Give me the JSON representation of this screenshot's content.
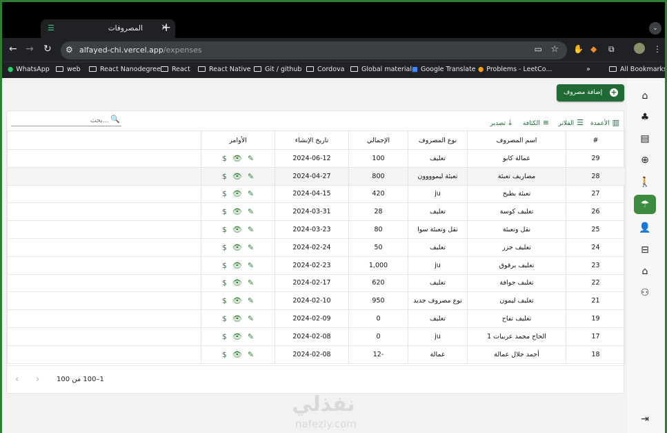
{
  "browser": {
    "tab_title": "المصروفات",
    "tab_close": "✕",
    "new_tab": "+",
    "url_host": "alfayed-chi.vercel.app",
    "url_path": "/expenses",
    "all_bookmarks": "All Bookmarks",
    "bookmarks": [
      "WhatsApp",
      "web",
      "React Nanodegree",
      "React",
      "React Native",
      "Git / github",
      "Cordova",
      "Global material",
      "Google Translate",
      "Problems - LeetCo..."
    ]
  },
  "header": {
    "add_button": "إضافة مصروف"
  },
  "toolbar": {
    "columns": "الأعمدة",
    "filters": "الفلاتر",
    "density": "الكثافة",
    "export": "تصدير",
    "search_placeholder": "بحث..."
  },
  "table": {
    "columns": [
      "#",
      "اسم المصروف",
      "نوع المصروف",
      "الإجمالي",
      "تاريخ الإنشاء",
      "الأوامر"
    ],
    "rows": [
      {
        "id": "29",
        "name": "عمالة كابو",
        "type": "تغليف",
        "total": "100",
        "date": "2024-06-12"
      },
      {
        "id": "28",
        "name": "مصاريف تعبئة",
        "type": "تعبئة ليموووون",
        "total": "800",
        "date": "2024-04-27"
      },
      {
        "id": "27",
        "name": "تعبئة بطيخ",
        "type": "ju",
        "total": "420",
        "date": "2024-04-15"
      },
      {
        "id": "26",
        "name": "تغليف كوسة",
        "type": "تغليف",
        "total": "28",
        "date": "2024-03-31"
      },
      {
        "id": "25",
        "name": "نقل وتعبئة",
        "type": "نقل وتعبئة سوا",
        "total": "80",
        "date": "2024-03-23"
      },
      {
        "id": "24",
        "name": "تغليف جزر",
        "type": "تغليف",
        "total": "50",
        "date": "2024-02-24"
      },
      {
        "id": "23",
        "name": "تغليف برقوق",
        "type": "ju",
        "total": "1,000",
        "date": "2024-02-23"
      },
      {
        "id": "22",
        "name": "تغليف جوافة",
        "type": "تغليف",
        "total": "620",
        "date": "2024-02-17"
      },
      {
        "id": "21",
        "name": "تغليف ليمون",
        "type": "نوع مصروف جديد",
        "total": "950",
        "date": "2024-02-10"
      },
      {
        "id": "19",
        "name": "تغليف تفاح",
        "type": "تغليف",
        "total": "0",
        "date": "2024-02-09"
      },
      {
        "id": "17",
        "name": "الحاج محمد عربيات 1",
        "type": "ju",
        "total": "0",
        "date": "2024-02-08"
      },
      {
        "id": "18",
        "name": "أحمد جلال عمالة",
        "type": "عمالة",
        "total": "-12",
        "date": "2024-02-08"
      }
    ]
  },
  "pagination": {
    "text": "1–100 من 100"
  },
  "watermark": {
    "arabic": "نفذلي",
    "latin": "nafezly.com"
  },
  "colors": {
    "primary": "#1f6a35",
    "active_sidebar": "#3d8b40",
    "frame": "#2f7d32"
  },
  "sidebar_icons": [
    "home-icon",
    "tree-icon",
    "document-icon",
    "add-circle-icon",
    "hiker-icon",
    "expense-icon",
    "user-icon",
    "inbox-icon",
    "bank-icon",
    "group-icon"
  ]
}
